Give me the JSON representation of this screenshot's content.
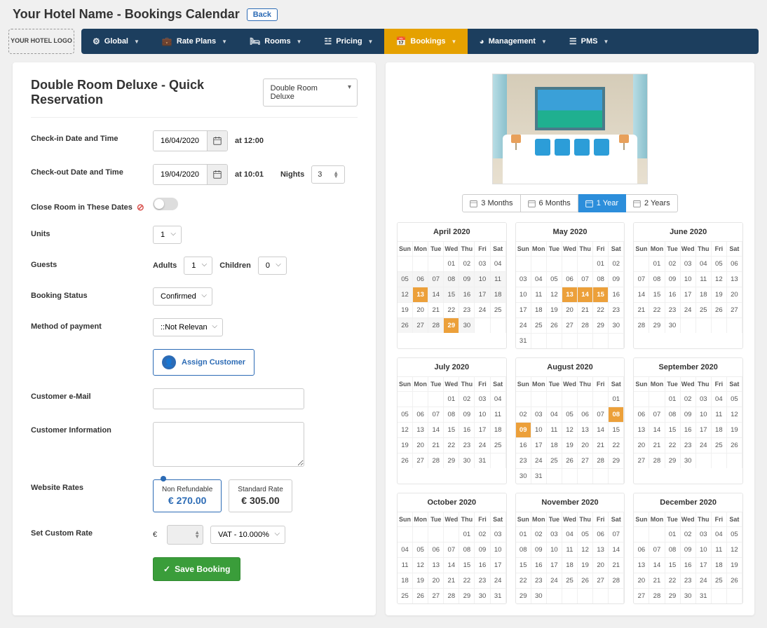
{
  "header": {
    "title": "Your Hotel Name - Bookings Calendar",
    "back": "Back",
    "logo": "YOUR HOTEL LOGO"
  },
  "nav": [
    {
      "icon": "⚙",
      "label": "Global"
    },
    {
      "icon": "💼",
      "label": "Rate Plans"
    },
    {
      "icon": "🛏",
      "label": "Rooms"
    },
    {
      "icon": "☳",
      "label": "Pricing"
    },
    {
      "icon": "📅",
      "label": "Bookings",
      "active": true
    },
    {
      "icon": "◕",
      "label": "Management"
    },
    {
      "icon": "☰",
      "label": "PMS"
    }
  ],
  "quick": {
    "title": "Double Room Deluxe - Quick Reservation",
    "room_select": "Double Room Deluxe",
    "labels": {
      "checkin": "Check-in Date and Time",
      "checkout": "Check-out Date and Time",
      "close_room": "Close Room in These Dates",
      "units": "Units",
      "guests": "Guests",
      "adults": "Adults",
      "children": "Children",
      "status": "Booking Status",
      "payment": "Method of payment",
      "email": "Customer e-Mail",
      "info": "Customer Information",
      "website_rates": "Website Rates",
      "custom_rate": "Set Custom Rate",
      "nights": "Nights",
      "assign": "Assign Customer",
      "save": "Save Booking"
    },
    "checkin": "16/04/2020",
    "checkin_time": "at 12:00",
    "checkout": "19/04/2020",
    "checkout_time": "at 10:01",
    "nights": "3",
    "units": "1",
    "adults": "1",
    "children": "0",
    "status": "Confirmed",
    "payment": "::Not Relevant::",
    "rates": [
      {
        "name": "Non Refundable",
        "price": "€ 270.00",
        "selected": true
      },
      {
        "name": "Standard Rate",
        "price": "€ 305.00",
        "selected": false
      }
    ],
    "currency": "€",
    "vat": "VAT - 10.000%"
  },
  "periods": [
    {
      "label": "3 Months"
    },
    {
      "label": "6 Months"
    },
    {
      "label": "1 Year",
      "active": true
    },
    {
      "label": "2 Years"
    }
  ],
  "dow": [
    "Sun",
    "Mon",
    "Tue",
    "Wed",
    "Thu",
    "Fri",
    "Sat"
  ],
  "months": [
    {
      "title": "April 2020",
      "offset": 3,
      "days": 30,
      "hl": [
        13,
        29
      ],
      "sel": [
        5,
        6,
        7,
        8,
        9,
        10,
        11,
        12,
        14,
        15,
        16,
        17,
        18,
        26,
        27,
        28,
        30
      ]
    },
    {
      "title": "May 2020",
      "offset": 5,
      "days": 31,
      "hl": [
        13,
        14,
        15
      ]
    },
    {
      "title": "June 2020",
      "offset": 1,
      "days": 30,
      "hl": []
    },
    {
      "title": "July 2020",
      "offset": 3,
      "days": 31,
      "hl": []
    },
    {
      "title": "August 2020",
      "offset": 6,
      "days": 31,
      "hl": [
        8,
        9
      ]
    },
    {
      "title": "September 2020",
      "offset": 2,
      "days": 30,
      "hl": []
    },
    {
      "title": "October 2020",
      "offset": 4,
      "days": 31,
      "hl": []
    },
    {
      "title": "November 2020",
      "offset": 0,
      "days": 30,
      "hl": []
    },
    {
      "title": "December 2020",
      "offset": 2,
      "days": 31,
      "hl": []
    }
  ]
}
